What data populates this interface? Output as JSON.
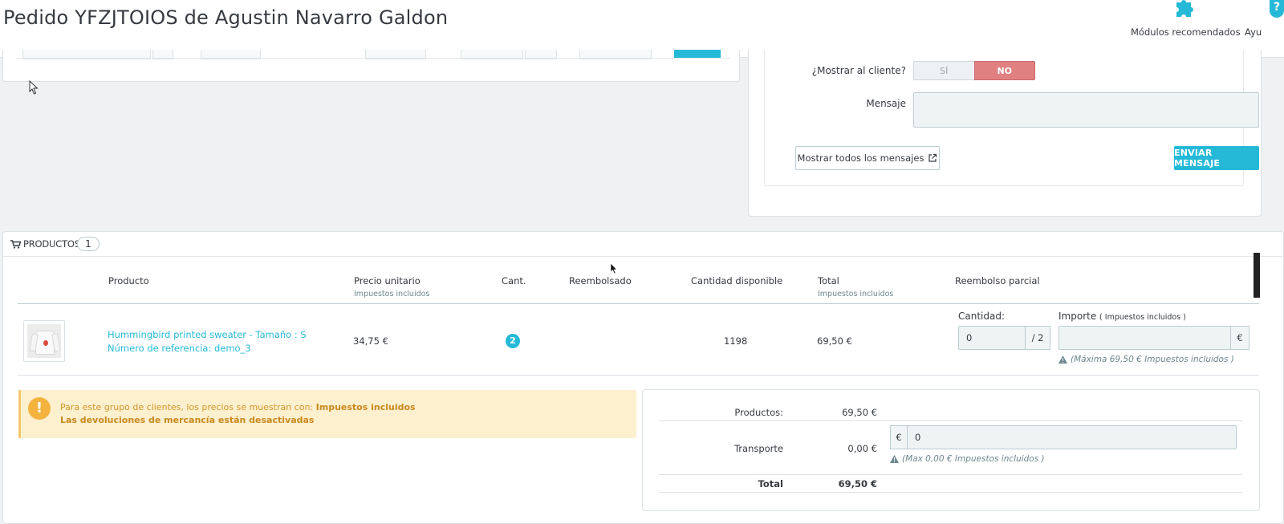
{
  "header": {
    "title": "Pedido YFZJTOIOS de Agustin Navarro Galdon",
    "modules_label": "Módulos recomendados",
    "help_label": "Ayu"
  },
  "messages": {
    "show_client_label": "¿Mostrar al cliente?",
    "toggle_yes": "SÍ",
    "toggle_no": "NO",
    "message_label": "Mensaje",
    "message_value": "",
    "show_all_button": "Mostrar todos los mensajes",
    "send_button": "ENVIAR MENSAJE"
  },
  "products": {
    "title": "PRODUCTOS",
    "count": "1",
    "columns": {
      "product": "Producto",
      "unit_price": "Precio unitario",
      "unit_price_sub": "Impuestos incluidos",
      "qty": "Cant.",
      "refunded": "Reembolsado",
      "available": "Cantidad disponible",
      "total": "Total",
      "total_sub": "Impuestos incluidos",
      "partial_refund": "Reembolso parcial"
    },
    "rows": [
      {
        "name": "Hummingbird printed sweater - Tamaño : S",
        "reference": "Número de referencia: demo_3",
        "unit_price": "34,75 €",
        "qty": "2",
        "available": "1198",
        "total": "69,50 €",
        "refund_qty_label": "Cantidad:",
        "refund_qty_value": "0",
        "refund_qty_max": "/ 2",
        "refund_amount_label": "Importe",
        "refund_amount_sub": "( Impuestos incluidos )",
        "refund_amount_value": "",
        "currency": "€",
        "refund_hint": "(Máxima 69,50 € Impuestos incluidos )"
      }
    ],
    "alert": {
      "line1_prefix": "Para este grupo de clientes, los precios se muestran con: ",
      "line1_bold": "Impuestos incluidos",
      "line2": "Las devoluciones de mercancía están desactivadas"
    },
    "totals": {
      "products_label": "Productos:",
      "products_value": "69,50 €",
      "shipping_label": "Transporte",
      "shipping_value": "0,00 €",
      "shipping_currency": "€",
      "shipping_input": "0",
      "shipping_hint": "(Max 0,00 € Impuestos incluidos )",
      "total_label": "Total",
      "total_value": "69,50 €"
    }
  },
  "icons": {
    "modules": "puzzle-icon",
    "help": "help-icon",
    "cart": "cart-icon",
    "external": "external-link-icon",
    "warning": "warning-icon"
  },
  "colors": {
    "primary": "#25b9d7",
    "danger_toggle": "#e08080",
    "alert_bg": "#fdf0cf",
    "alert_text": "#d6962a"
  }
}
